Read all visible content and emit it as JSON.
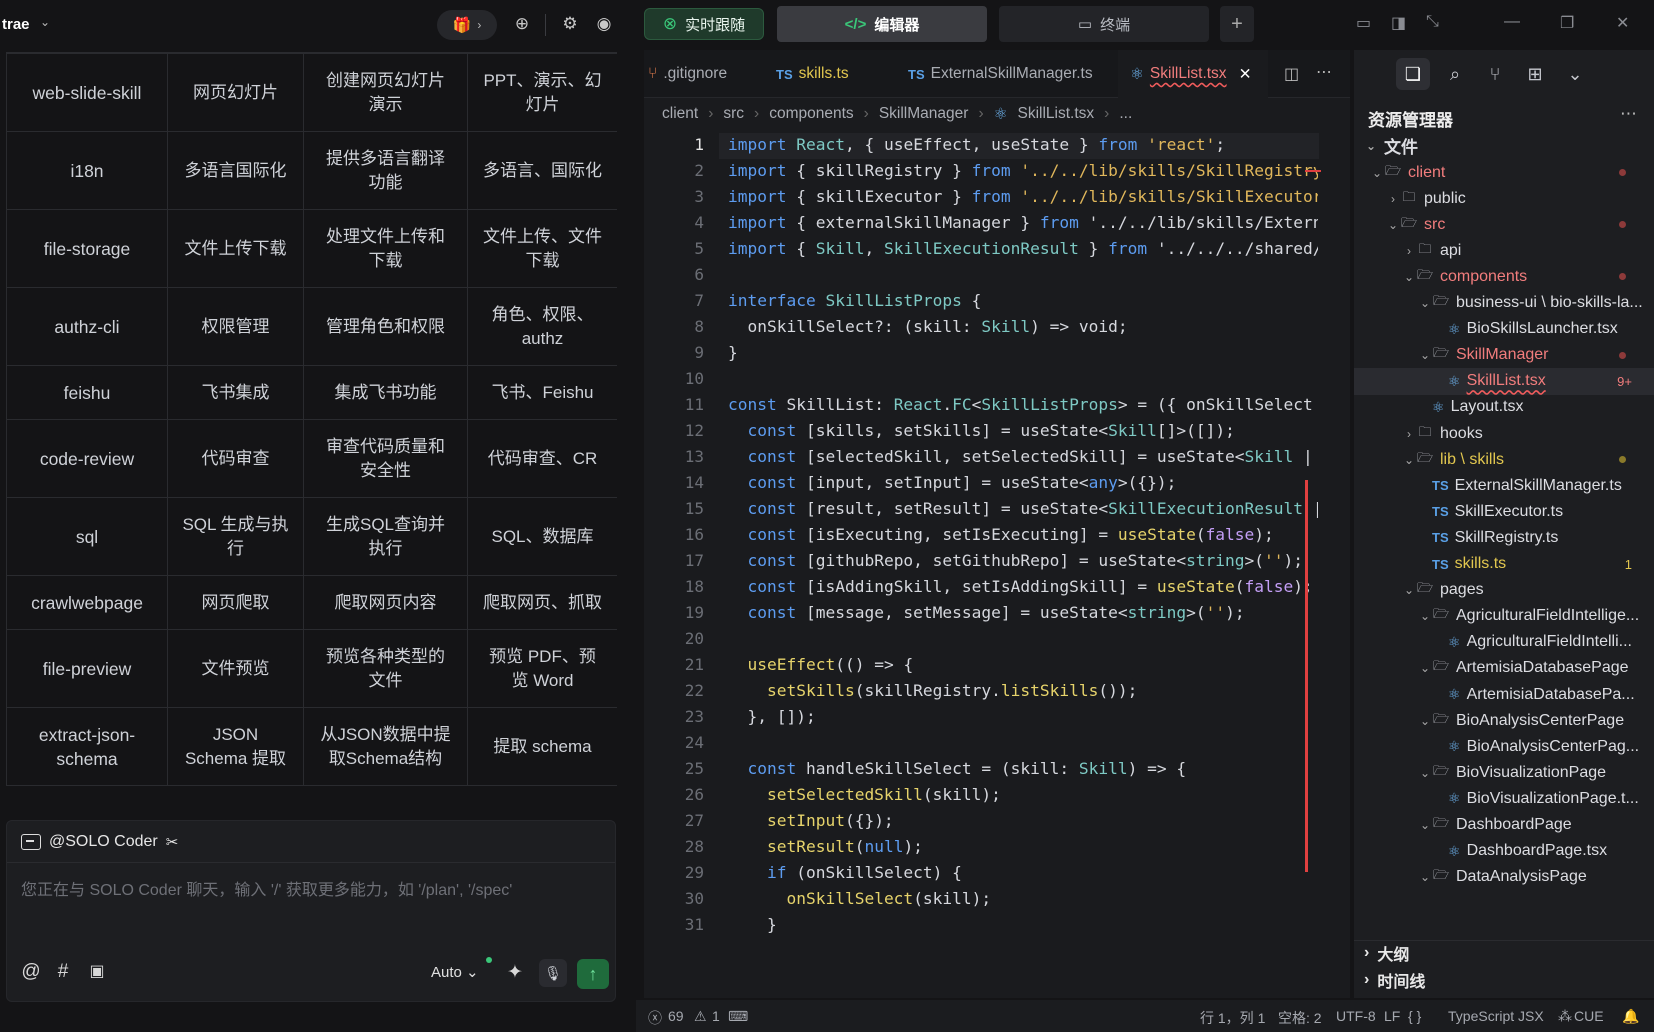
{
  "app": {
    "name": "trae"
  },
  "table": {
    "rows": [
      [
        "web-slide-skill",
        "网页幻灯片",
        "创建网页幻灯片演示",
        "PPT、演示、幻灯片"
      ],
      [
        "i18n",
        "多语言国际化",
        "提供多语言翻译功能",
        "多语言、国际化"
      ],
      [
        "file-storage",
        "文件上传下载",
        "处理文件上传和下载",
        "文件上传、文件下载"
      ],
      [
        "authz-cli",
        "权限管理",
        "管理角色和权限",
        "角色、权限、authz"
      ],
      [
        "feishu",
        "飞书集成",
        "集成飞书功能",
        "飞书、Feishu"
      ],
      [
        "code-review",
        "代码审查",
        "审查代码质量和安全性",
        "代码审查、CR"
      ],
      [
        "sql",
        "SQL 生成与执行",
        "生成SQL查询并执行",
        "SQL、数据库"
      ],
      [
        "crawlwebpage",
        "网页爬取",
        "爬取网页内容",
        "爬取网页、抓取"
      ],
      [
        "file-preview",
        "文件预览",
        "预览各种类型的文件",
        "预览 PDF、预览 Word"
      ],
      [
        "extract-json-schema",
        "JSON Schema 提取",
        "从JSON数据中提取Schema结构",
        "提取 schema"
      ]
    ]
  },
  "chat": {
    "agent": "@SOLO Coder",
    "placeholder": "您正在与 SOLO Coder 聊天，输入 '/' 获取更多能力，如 '/plan', '/spec'",
    "mode": "Auto"
  },
  "topTabs": {
    "follow": "实时跟随",
    "editor": "编辑器",
    "terminal": "终端"
  },
  "fileTabs": [
    {
      "name": ".gitignore",
      "prefix": ""
    },
    {
      "name": "skills.ts",
      "prefix": "TS"
    },
    {
      "name": "ExternalSkillManager.ts",
      "prefix": "TS"
    },
    {
      "name": "SkillList.tsx",
      "prefix": "⚛"
    }
  ],
  "breadcrumb": [
    "client",
    "src",
    "components",
    "SkillManager",
    "SkillList.tsx",
    "..."
  ],
  "code": {
    "lines": [
      "import React, { useEffect, useState } from 'react';",
      "import { skillRegistry } from '../../lib/skills/SkillRegistry';",
      "import { skillExecutor } from '../../lib/skills/SkillExecutor';",
      "import { externalSkillManager } from '../../lib/skills/External",
      "import { Skill, SkillExecutionResult } from '../../../shared/sk",
      "",
      "interface SkillListProps {",
      "  onSkillSelect?: (skill: Skill) => void;",
      "}",
      "",
      "const SkillList: React.FC<SkillListProps> = ({ onSkillSelect })",
      "  const [skills, setSkills] = useState<Skill[]>([]);",
      "  const [selectedSkill, setSelectedSkill] = useState<Skill | nu",
      "  const [input, setInput] = useState<any>({});",
      "  const [result, setResult] = useState<SkillExecutionResult | n",
      "  const [isExecuting, setIsExecuting] = useState(false);",
      "  const [githubRepo, setGithubRepo] = useState<string>('');",
      "  const [isAddingSkill, setIsAddingSkill] = useState(false);",
      "  const [message, setMessage] = useState<string>('');",
      "",
      "  useEffect(() => {",
      "    setSkills(skillRegistry.listSkills());",
      "  }, []);",
      "",
      "  const handleSkillSelect = (skill: Skill) => {",
      "    setSelectedSkill(skill);",
      "    setInput({});",
      "    setResult(null);",
      "    if (onSkillSelect) {",
      "      onSkillSelect(skill);",
      "    }"
    ]
  },
  "explorer": {
    "title": "资源管理器",
    "section": "文件",
    "tree": [
      {
        "label": "client",
        "indent": 0,
        "type": "folder",
        "open": true,
        "color": "red",
        "dot": "red"
      },
      {
        "label": "public",
        "indent": 1,
        "type": "folder",
        "open": false
      },
      {
        "label": "src",
        "indent": 1,
        "type": "folder",
        "open": true,
        "color": "red",
        "dot": "red"
      },
      {
        "label": "api",
        "indent": 2,
        "type": "folder",
        "open": false
      },
      {
        "label": "components",
        "indent": 2,
        "type": "folder",
        "open": true,
        "color": "red",
        "dot": "red"
      },
      {
        "label": "business-ui \\ bio-skills-la...",
        "indent": 3,
        "type": "folder",
        "open": true
      },
      {
        "label": "BioSkillsLauncher.tsx",
        "indent": 4,
        "type": "react"
      },
      {
        "label": "SkillManager",
        "indent": 3,
        "type": "folder",
        "open": true,
        "color": "red",
        "dot": "red"
      },
      {
        "label": "SkillList.tsx",
        "indent": 4,
        "type": "react",
        "color": "red",
        "badge": "9+",
        "selected": true
      },
      {
        "label": "Layout.tsx",
        "indent": 3,
        "type": "react"
      },
      {
        "label": "hooks",
        "indent": 2,
        "type": "folder",
        "open": false
      },
      {
        "label": "lib \\ skills",
        "indent": 2,
        "type": "folder",
        "open": true,
        "color": "yellow",
        "dot": "yel"
      },
      {
        "label": "ExternalSkillManager.ts",
        "indent": 3,
        "type": "ts"
      },
      {
        "label": "SkillExecutor.ts",
        "indent": 3,
        "type": "ts"
      },
      {
        "label": "SkillRegistry.ts",
        "indent": 3,
        "type": "ts"
      },
      {
        "label": "skills.ts",
        "indent": 3,
        "type": "ts",
        "color": "yellow",
        "badge": "1"
      },
      {
        "label": "pages",
        "indent": 2,
        "type": "folder",
        "open": true
      },
      {
        "label": "AgriculturalFieldIntellige...",
        "indent": 3,
        "type": "folder",
        "open": true
      },
      {
        "label": "AgriculturalFieldIntelli...",
        "indent": 4,
        "type": "react"
      },
      {
        "label": "ArtemisiaDatabasePage",
        "indent": 3,
        "type": "folder",
        "open": true
      },
      {
        "label": "ArtemisiaDatabasePa...",
        "indent": 4,
        "type": "react"
      },
      {
        "label": "BioAnalysisCenterPage",
        "indent": 3,
        "type": "folder",
        "open": true
      },
      {
        "label": "BioAnalysisCenterPag...",
        "indent": 4,
        "type": "react"
      },
      {
        "label": "BioVisualizationPage",
        "indent": 3,
        "type": "folder",
        "open": true
      },
      {
        "label": "BioVisualizationPage.t...",
        "indent": 4,
        "type": "react"
      },
      {
        "label": "DashboardPage",
        "indent": 3,
        "type": "folder",
        "open": true
      },
      {
        "label": "DashboardPage.tsx",
        "indent": 4,
        "type": "react"
      },
      {
        "label": "DataAnalysisPage",
        "indent": 3,
        "type": "folder",
        "open": true
      }
    ],
    "outline": "大纲",
    "timeline": "时间线"
  },
  "status": {
    "errors": "69",
    "warnings": "1",
    "position": "行 1，列 1",
    "spaces": "空格: 2",
    "encoding": "UTF-8",
    "eol": "LF",
    "braces": "{ }",
    "language": "TypeScript JSX",
    "cue": "CUE"
  }
}
